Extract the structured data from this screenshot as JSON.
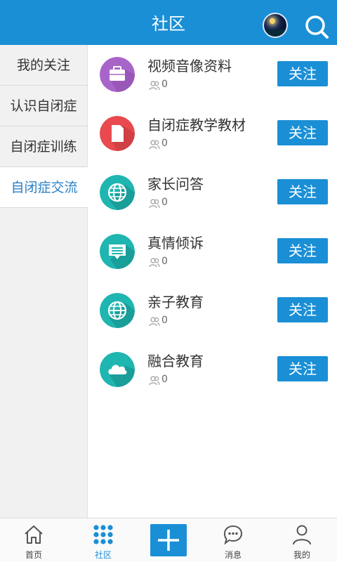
{
  "header": {
    "title": "社区"
  },
  "sidebar": {
    "items": [
      {
        "label": "我的关注",
        "active": false
      },
      {
        "label": "认识自闭症",
        "active": false
      },
      {
        "label": "自闭症训练",
        "active": false
      },
      {
        "label": "自闭症交流",
        "active": true
      }
    ]
  },
  "list": {
    "items": [
      {
        "title": "视频音像资料",
        "count": "0",
        "button": "关注",
        "icon": "briefcase-icon",
        "color": "#a865c9"
      },
      {
        "title": "自闭症教学教材",
        "count": "0",
        "button": "关注",
        "icon": "document-icon",
        "color": "#e84a4f"
      },
      {
        "title": "家长问答",
        "count": "0",
        "button": "关注",
        "icon": "globe-icon",
        "color": "#1fb5b0"
      },
      {
        "title": "真情倾诉",
        "count": "0",
        "button": "关注",
        "icon": "chat-icon",
        "color": "#1fb5b0"
      },
      {
        "title": "亲子教育",
        "count": "0",
        "button": "关注",
        "icon": "globe-icon",
        "color": "#1fb5b0"
      },
      {
        "title": "融合教育",
        "count": "0",
        "button": "关注",
        "icon": "cloud-icon",
        "color": "#1fb5b0"
      }
    ]
  },
  "bottom_nav": {
    "items": [
      {
        "label": "首页",
        "icon": "home-icon",
        "active": false
      },
      {
        "label": "社区",
        "icon": "grid-icon",
        "active": true
      },
      {
        "label": "",
        "icon": "plus-icon",
        "active": false
      },
      {
        "label": "消息",
        "icon": "message-icon",
        "active": false
      },
      {
        "label": "我的",
        "icon": "user-icon",
        "active": false
      }
    ]
  },
  "colors": {
    "accent": "#1a8fd6",
    "active_text": "#2a80c6"
  }
}
